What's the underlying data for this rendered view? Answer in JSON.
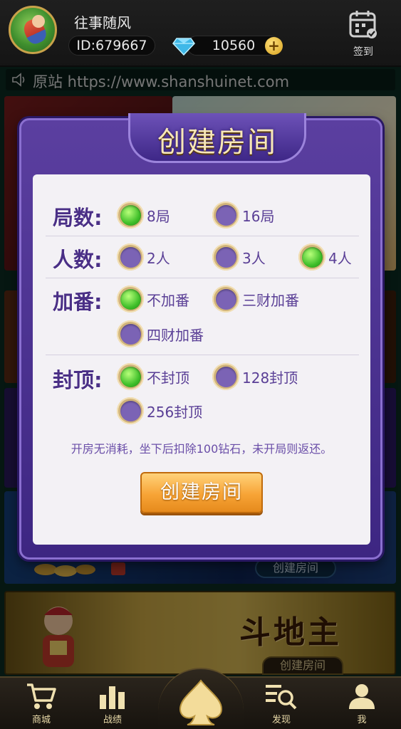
{
  "topbar": {
    "nickname": "往事随风",
    "user_id": "ID:679667",
    "diamonds": "10560",
    "plus": "+",
    "signin_label": "签到"
  },
  "notice": {
    "text": "原站 https://www.shanshuinet.com"
  },
  "background": {
    "card_button_1": "创建房间",
    "card_button_2": "创建房间",
    "ddz_title": "斗地主"
  },
  "modal": {
    "title": "创建房间",
    "rows": [
      {
        "label": "局数:",
        "options": [
          {
            "text": "8局",
            "selected": true
          },
          {
            "text": "16局",
            "selected": false
          }
        ]
      },
      {
        "label": "人数:",
        "options": [
          {
            "text": "2人",
            "selected": false
          },
          {
            "text": "3人",
            "selected": false
          },
          {
            "text": "4人",
            "selected": true
          }
        ]
      },
      {
        "label": "加番:",
        "options": [
          {
            "text": "不加番",
            "selected": true
          },
          {
            "text": "三财加番",
            "selected": false
          },
          {
            "text": "四财加番",
            "selected": false
          }
        ]
      },
      {
        "label": "封顶:",
        "options": [
          {
            "text": "不封顶",
            "selected": true
          },
          {
            "text": "128封顶",
            "selected": false
          },
          {
            "text": "256封顶",
            "selected": false
          }
        ]
      }
    ],
    "note": "开房无消耗，坐下后扣除100钻石，未开局则返还。",
    "create_button": "创建房间"
  },
  "bottom_nav": {
    "items": [
      {
        "label": "商城",
        "icon": "cart-icon"
      },
      {
        "label": "战绩",
        "icon": "bar-chart-icon"
      },
      {
        "label": "",
        "icon": "spade-icon"
      },
      {
        "label": "发现",
        "icon": "search-list-icon"
      },
      {
        "label": "我",
        "icon": "user-icon"
      }
    ]
  },
  "colors": {
    "modal_purple": "#5b3fa0",
    "panel_bg": "#f3f1f5",
    "label_purple": "#4a2f86",
    "radio_selected_green": "#3fbf2a",
    "button_orange": "#f7a436",
    "nav_gold": "#e8d9a8"
  }
}
